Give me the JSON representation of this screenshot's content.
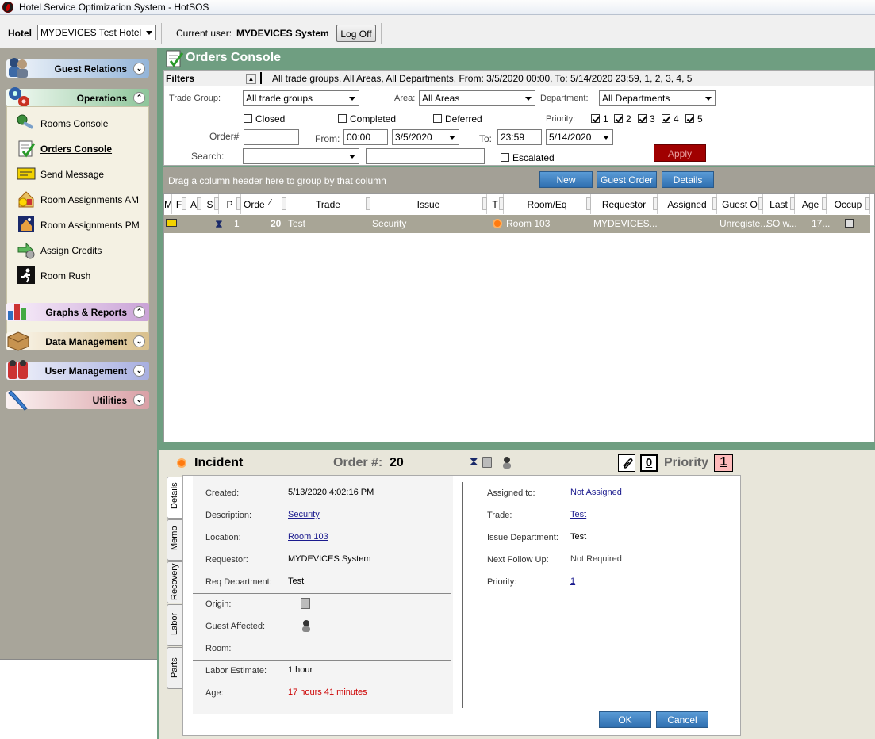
{
  "window": {
    "title": "Hotel Service Optimization System - HotSOS"
  },
  "toolbar": {
    "hotel_label": "Hotel",
    "hotel_value": "MYDEVICES Test Hotel",
    "current_user_label": "Current user:",
    "current_user": "MYDEVICES System",
    "logoff_label": "Log Off"
  },
  "sidebar": {
    "groups": [
      {
        "label": "Guest Relations",
        "chevron": "⌄"
      },
      {
        "label": "Operations",
        "chevron": "⌃"
      },
      {
        "label": "Graphs & Reports",
        "chevron": "⌃"
      },
      {
        "label": "Data Management",
        "chevron": "⌄"
      },
      {
        "label": "User Management",
        "chevron": "⌄"
      },
      {
        "label": "Utilities",
        "chevron": "⌄"
      }
    ],
    "items": [
      {
        "label": "Rooms Console",
        "icon": "rooms-icon"
      },
      {
        "label": "Orders Console",
        "icon": "orders-icon"
      },
      {
        "label": "Send Message",
        "icon": "message-icon"
      },
      {
        "label": "Room Assignments AM",
        "icon": "assignments-am-icon"
      },
      {
        "label": "Room Assignments PM",
        "icon": "assignments-pm-icon"
      },
      {
        "label": "Assign Credits",
        "icon": "credits-icon"
      },
      {
        "label": "Room Rush",
        "icon": "rush-icon"
      }
    ]
  },
  "console": {
    "title": "Orders Console",
    "filters_label": "Filters",
    "filters_summary": "All trade groups, All Areas, All Departments, From: 3/5/2020 00:00, To: 5/14/2020 23:59, 1, 2, 3, 4, 5",
    "trade_group_label": "Trade Group:",
    "trade_group_value": "All trade groups",
    "area_label": "Area:",
    "area_value": "All Areas",
    "department_label": "Department:",
    "department_value": "All Departments",
    "closed_label": "Closed",
    "completed_label": "Completed",
    "deferred_label": "Deferred",
    "priority_label": "Priority:",
    "priorities": [
      "1",
      "2",
      "3",
      "4",
      "5"
    ],
    "order_label": "Order#",
    "from_label": "From:",
    "from_time": "00:00",
    "from_date": "3/5/2020",
    "to_label": "To:",
    "to_time": "23:59",
    "to_date": "5/14/2020",
    "apply_label": "Apply",
    "search_label": "Search:",
    "escalated_label": "Escalated",
    "group_hint": "Drag a column header here to group by that column",
    "new_label": "New",
    "guest_order_label": "Guest Order",
    "details_label": "Details"
  },
  "grid": {
    "columns": [
      "M",
      "F",
      "A",
      "S",
      "P",
      "Orde",
      "Trade",
      "Issue",
      "T",
      "Room/Eq",
      "Requestor",
      "Assigned",
      "Guest O",
      "Last",
      "Age",
      "Occup"
    ],
    "rows": [
      {
        "p": "1",
        "order": "20",
        "trade": "Test",
        "issue": "Security",
        "room": "Room 103",
        "requestor": "MYDEVICES...",
        "assigned": "",
        "guest": "Unregiste...",
        "last": "SO w...",
        "age": "17..."
      }
    ]
  },
  "detail": {
    "type": "Incident",
    "order_label": "Order #:",
    "order_number": "20",
    "attach_count": "0",
    "priority_label": "Priority",
    "priority_value": "1",
    "tabs": [
      "Details",
      "Memo",
      "Recovery",
      "Labor",
      "Parts"
    ],
    "created_label": "Created:",
    "created": "5/13/2020 4:02:16 PM",
    "description_label": "Description:",
    "description": "Security",
    "location_label": "Location:",
    "location": "Room 103",
    "requestor_label": "Requestor:",
    "requestor": "MYDEVICES System",
    "req_dept_label": "Req Department:",
    "req_dept": "Test",
    "origin_label": "Origin:",
    "guest_affected_label": "Guest Affected:",
    "room_label": "Room:",
    "labor_label": "Labor Estimate:",
    "labor": "1 hour",
    "age_label": "Age:",
    "age": "17 hours 41 minutes",
    "assigned_label": "Assigned to:",
    "assigned": "Not Assigned",
    "trade_label": "Trade:",
    "trade": "Test",
    "issue_dept_label": "Issue Department:",
    "issue_dept": "Test",
    "followup_label": "Next Follow Up:",
    "followup": "Not Required",
    "priority_row_label": "Priority:",
    "priority_row": "1",
    "ok_label": "OK",
    "cancel_label": "Cancel"
  },
  "colors": {
    "accent_green": "#6f9e81",
    "age_red": "#cc0000",
    "button_blue": "#2f6fb0"
  }
}
